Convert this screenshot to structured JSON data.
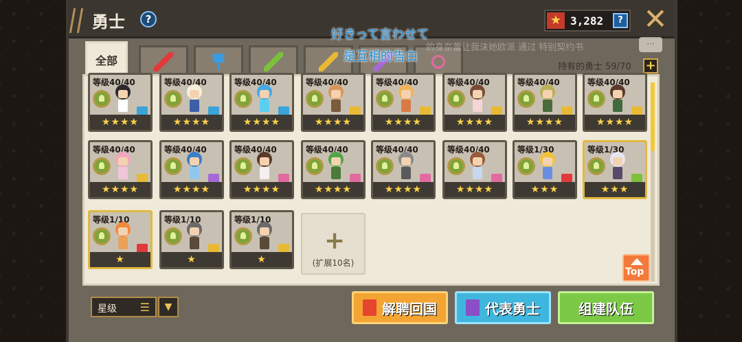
{
  "header": {
    "title": "勇士",
    "currency": "3,282",
    "currency_help": "?",
    "help": "?"
  },
  "overlay": {
    "line1": "好きって言わせて",
    "line2": "是互相的告白",
    "faded": "的身奈蕾让我沫她欧派  通过  特别契约书"
  },
  "tabs": [
    {
      "label": "全部",
      "icon": null
    },
    {
      "label": "",
      "icon": "sword-icon",
      "color": "#e23a3a"
    },
    {
      "label": "",
      "icon": "axe-icon",
      "color": "#3a9be0"
    },
    {
      "label": "",
      "icon": "bow-icon",
      "color": "#7bc13a"
    },
    {
      "label": "",
      "icon": "staff-icon",
      "color": "#e8b933"
    },
    {
      "label": "",
      "icon": "wand-icon",
      "color": "#a66ad6"
    },
    {
      "label": "",
      "icon": "flask-icon",
      "color": "#e36aa0"
    }
  ],
  "owned_label": "持有的勇士 59/70",
  "cards": [
    {
      "level": "等级40/40",
      "stars": "★★★★",
      "hair": "#2a2a2a",
      "body": "#ffffff",
      "weapon": "#3aa3d8",
      "gold": false
    },
    {
      "level": "等级40/40",
      "stars": "★★★★",
      "hair": "#f4f1da",
      "body": "#3d5fa8",
      "weapon": "#3aa3d8",
      "gold": false
    },
    {
      "level": "等级40/40",
      "stars": "★★★★",
      "hair": "#45a9e3",
      "body": "#5acff0",
      "weapon": "#3aa3d8",
      "gold": false
    },
    {
      "level": "等级40/40",
      "stars": "★★★★",
      "hair": "#d9965a",
      "body": "#7a5b3c",
      "weapon": "#e8b933",
      "gold": false
    },
    {
      "level": "等级40/40",
      "stars": "★★★★",
      "hair": "#f1b45a",
      "body": "#d97a45",
      "weapon": "#e8b933",
      "gold": false
    },
    {
      "level": "等级40/40",
      "stars": "★★★★",
      "hair": "#7a4a35",
      "body": "#f5d5d5",
      "weapon": "#e8b933",
      "gold": false
    },
    {
      "level": "等级40/40",
      "stars": "★★★★",
      "hair": "#b9b15a",
      "body": "#4c6b3a",
      "weapon": "#e8b933",
      "gold": false
    },
    {
      "level": "等级40/40",
      "stars": "★★★★",
      "hair": "#5a3a2a",
      "body": "#3f6a3e",
      "weapon": "#e8b933",
      "gold": false
    },
    {
      "level": "等级40/40",
      "stars": "★★★★",
      "hair": "#f2a6c0",
      "body": "#f0c7d8",
      "weapon": "#e8b933",
      "gold": false
    },
    {
      "level": "等级40/40",
      "stars": "★★★★",
      "hair": "#3a7fc8",
      "body": "#8fc7ef",
      "weapon": "#a66ad6",
      "gold": false
    },
    {
      "level": "等级40/40",
      "stars": "★★★★",
      "hair": "#5a3a2a",
      "body": "#f5f0ef",
      "weapon": "#e36aa0",
      "gold": false
    },
    {
      "level": "等级40/40",
      "stars": "★★★★",
      "hair": "#4fa64a",
      "body": "#4c7a3a",
      "weapon": "#e36aa0",
      "gold": false
    },
    {
      "level": "等级40/40",
      "stars": "★★★★",
      "hair": "#8a8a8a",
      "body": "#5a5a5a",
      "weapon": "#e36aa0",
      "gold": false
    },
    {
      "level": "等级40/40",
      "stars": "★★★★",
      "hair": "#9a5a3a",
      "body": "#c7d7f0",
      "weapon": "#e36aa0",
      "gold": false
    },
    {
      "level": "等级1/30",
      "stars": "★★★",
      "hair": "#f2c23a",
      "body": "#6a8fe0",
      "weapon": "#e23a3a",
      "gold": false
    },
    {
      "level": "等级1/30",
      "stars": "★★★",
      "hair": "#e8e6f0",
      "body": "#5a4a6a",
      "weapon": "#7bc13a",
      "gold": true
    },
    {
      "level": "等级1/10",
      "stars": "★",
      "hair": "#f28a3a",
      "body": "#e8a25a",
      "weapon": "#e23a3a",
      "gold": true
    },
    {
      "level": "等级1/10",
      "stars": "★",
      "hair": "#6a6a6a",
      "body": "#5a4a3a",
      "weapon": "#e8b933",
      "gold": false
    },
    {
      "level": "等级1/10",
      "stars": "★",
      "hair": "#6a6a6a",
      "body": "#5a4a3a",
      "weapon": "#e8b933",
      "gold": false
    }
  ],
  "expand": {
    "plus": "+",
    "label": "(扩展10名)"
  },
  "top_button": "Top",
  "sort": {
    "label": "星级",
    "dropdown": "▼",
    "lines": "☰"
  },
  "buttons": {
    "dismiss": "解聘回国",
    "representative": "代表勇士",
    "form_team": "组建队伍"
  },
  "close": "✕"
}
